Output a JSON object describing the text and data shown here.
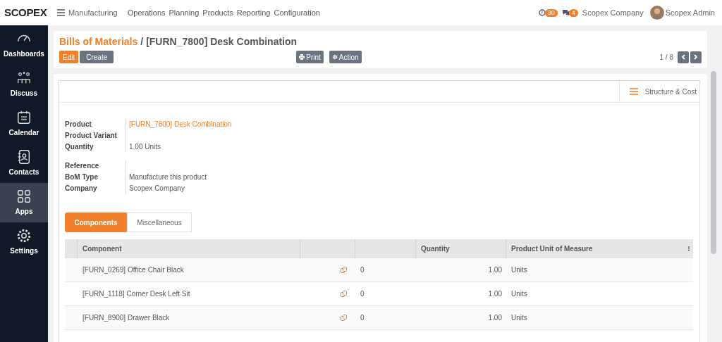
{
  "topbar": {
    "logo": "SCOPEX",
    "app": "Manufacturing",
    "menu": [
      "Operations",
      "Planning",
      "Products",
      "Reporting",
      "Configuration"
    ],
    "activity_count": "30",
    "message_count": "4",
    "company": "Scopex Company",
    "user": "Scopex Admin"
  },
  "sidebar": {
    "items": [
      {
        "kind": "dashboards",
        "label": "Dashboards",
        "selected": false
      },
      {
        "kind": "discuss",
        "label": "Discuss",
        "selected": false
      },
      {
        "kind": "calendar",
        "label": "Calendar",
        "selected": false
      },
      {
        "kind": "contacts",
        "label": "Contacts",
        "selected": false
      },
      {
        "kind": "apps",
        "label": "Apps",
        "selected": true
      },
      {
        "kind": "settings",
        "label": "Settings",
        "selected": false
      }
    ]
  },
  "breadcrumb": {
    "parent": "Bills of Materials",
    "separator": "/",
    "current": "[FURN_7800] Desk Combination"
  },
  "buttons": {
    "edit": "Edit",
    "create": "Create",
    "print": "Print",
    "action": "Action"
  },
  "pager": "1 / 8",
  "structure_button": "Structure & Cost",
  "field_groups": [
    [
      {
        "label": "Product",
        "value": "[FURN_7800] Desk Combination",
        "kind": "link"
      },
      {
        "label": "Product Variant"
      },
      {
        "label": "Quantity",
        "value": "1.00 Units"
      }
    ],
    [
      {
        "label": "Reference"
      },
      {
        "label": "BoM Type",
        "value": "Manufacture this product"
      },
      {
        "label": "Company",
        "value": "Scopex Company"
      }
    ]
  ],
  "tabs": [
    {
      "label": "Components",
      "selected": true
    },
    {
      "label": "Miscellaneous",
      "selected": false
    }
  ],
  "table": {
    "columns": [
      "Component",
      "Quantity",
      "Product Unit of Measure"
    ],
    "rows": [
      {
        "component": "[FURN_0269] Office Chair Black",
        "column_4": "0",
        "quantity": "1.00",
        "uom": "Units"
      },
      {
        "component": "[FURN_1118] Corner Desk Left Sit",
        "column_4": "0",
        "quantity": "1.00",
        "uom": "Units"
      },
      {
        "component": "[FURN_8900] Drawer Black",
        "column_4": "0",
        "quantity": "1.00",
        "uom": "Units"
      }
    ]
  }
}
